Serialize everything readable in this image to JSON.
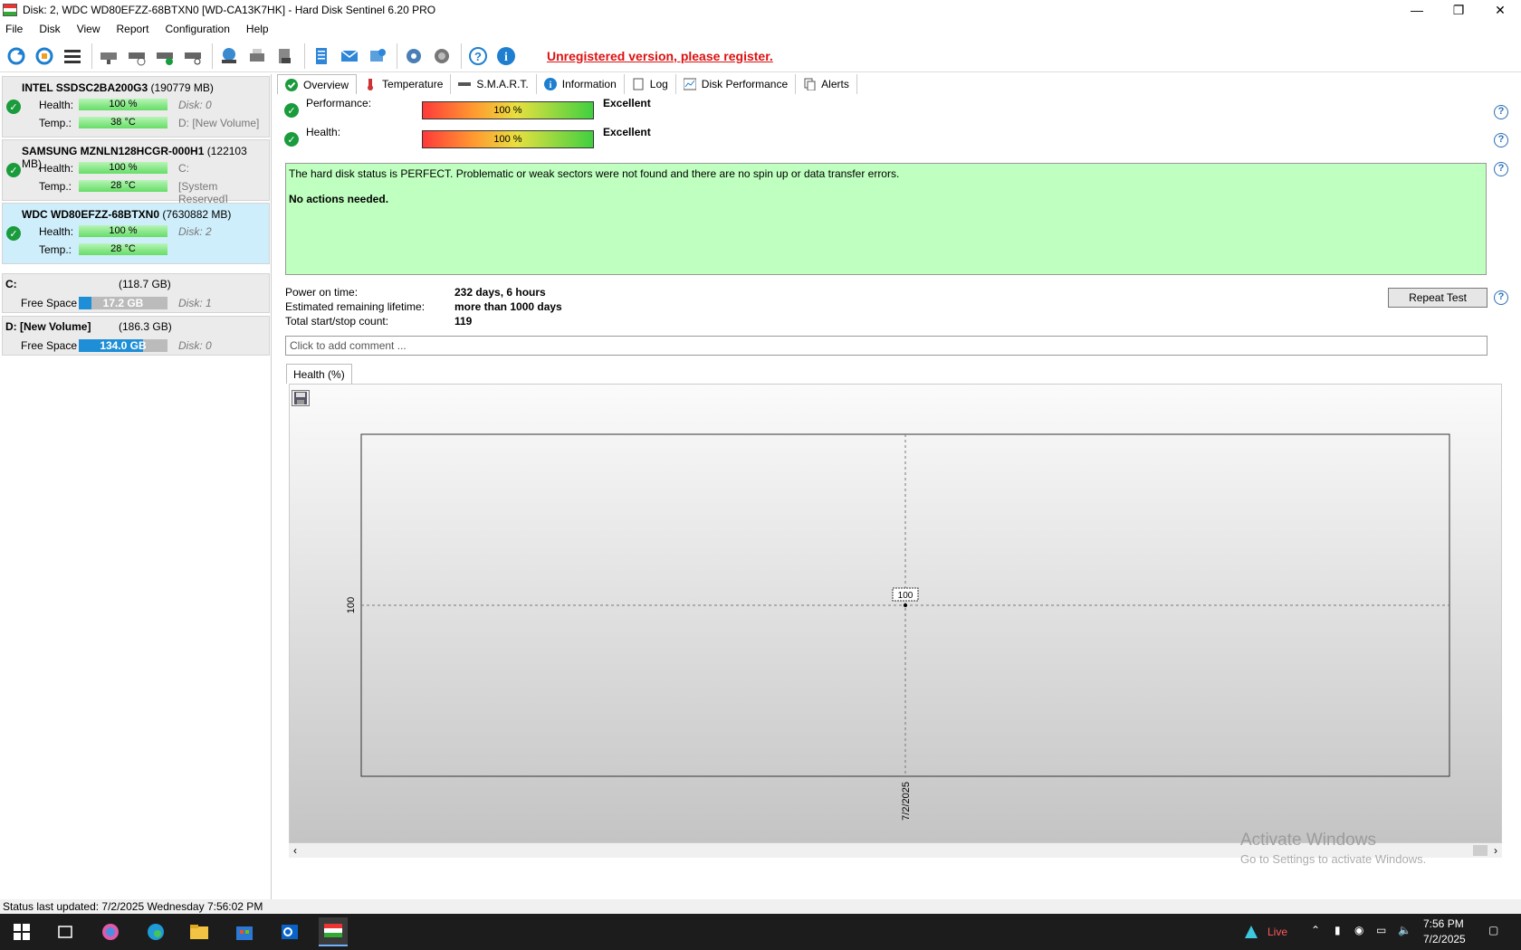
{
  "window": {
    "title": "Disk: 2, WDC WD80EFZZ-68BTXN0 [WD-CA13K7HK]  -  Hard Disk Sentinel 6.20 PRO",
    "minimize": "—",
    "restore": "❐",
    "close": "✕"
  },
  "menu": [
    "File",
    "Disk",
    "View",
    "Report",
    "Configuration",
    "Help"
  ],
  "register_link": "Unregistered version, please register.",
  "disks": [
    {
      "name": "INTEL SSDSC2BA200G3",
      "size": "(190779 MB)",
      "health_label": "Health:",
      "health": "100 %",
      "health_aside": "Disk: 0",
      "temp_label": "Temp.:",
      "temp": "38 °C",
      "temp_aside": "D: [New Volume]"
    },
    {
      "name": "SAMSUNG MZNLN128HCGR-000H1",
      "size": "(122103 MB)",
      "health_label": "Health:",
      "health": "100 %",
      "health_aside": "C:",
      "temp_label": "Temp.:",
      "temp": "28 °C",
      "temp_aside": "[System Reserved]"
    },
    {
      "name": "WDC WD80EFZZ-68BTXN0",
      "size": "(7630882 MB)",
      "health_label": "Health:",
      "health": "100 %",
      "health_aside": "Disk: 2",
      "temp_label": "Temp.:",
      "temp": "28 °C",
      "temp_aside": ""
    }
  ],
  "volumes": [
    {
      "name": "C:",
      "size": "(118.7 GB)",
      "free_label": "Free Space",
      "free": "17.2 GB",
      "free_fraction": 0.145,
      "disk": "Disk: 1"
    },
    {
      "name": "D: [New Volume]",
      "size": "(186.3 GB)",
      "free_label": "Free Space",
      "free": "134.0 GB",
      "free_fraction": 0.72,
      "disk": "Disk: 0"
    }
  ],
  "tabs": [
    "Overview",
    "Temperature",
    "S.M.A.R.T.",
    "Information",
    "Log",
    "Disk Performance",
    "Alerts"
  ],
  "overview": {
    "performance_label": "Performance:",
    "performance_value": "100 %",
    "performance_status": "Excellent",
    "health_label": "Health:",
    "health_value": "100 %",
    "health_status": "Excellent",
    "status_text": "The hard disk status is PERFECT. Problematic or weak sectors were not found and there are no spin up or data transfer errors.",
    "actions_text": "No actions needed.",
    "power_on_label": "Power on time:",
    "power_on_value": "232 days, 6 hours",
    "lifetime_label": "Estimated remaining lifetime:",
    "lifetime_value": "more than 1000 days",
    "startstop_label": "Total start/stop count:",
    "startstop_value": "119",
    "repeat_button": "Repeat Test",
    "comment_placeholder": "Click to add comment ...",
    "chart_tab": "Health (%)",
    "help": "?"
  },
  "chart_data": {
    "type": "line",
    "title": "",
    "xlabel": "",
    "ylabel": "",
    "x": [
      "7/2/2025"
    ],
    "series": [
      {
        "values": [
          100
        ]
      }
    ],
    "y_tick_labels": [
      "100"
    ],
    "data_labels": [
      "100"
    ],
    "grid": true
  },
  "watermark": {
    "line1": "Activate Windows",
    "line2": "Go to Settings to activate Windows."
  },
  "statusbar": "Status last updated: 7/2/2025 Wednesday 7:56:02 PM",
  "taskbar": {
    "live": "Live",
    "time": "7:56 PM",
    "date": "7/2/2025"
  },
  "colors": {
    "accent_green": "#1a9b3c",
    "status_bg": "#bfffbf",
    "register_red": "#dd1111",
    "free_bar": "#1e8fd6"
  }
}
